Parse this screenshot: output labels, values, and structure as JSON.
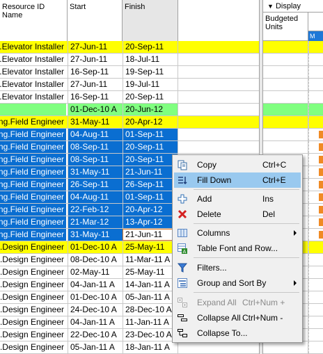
{
  "columns": {
    "resource": "Resource ID Name",
    "start": "Start",
    "finish": "Finish"
  },
  "display_tab": "Display",
  "right_columns": {
    "budgeted": "Budgeted Units",
    "mini": "M"
  },
  "rows": [
    {
      "resource": "Const.Elevator Installer",
      "start": "27-Jun-11",
      "finish": "20-Sep-11",
      "style": "yellow"
    },
    {
      "resource": "Const.Elevator Installer",
      "start": "27-Jun-11",
      "finish": "18-Jul-11",
      "style": ""
    },
    {
      "resource": "Const.Elevator Installer",
      "start": "16-Sep-11",
      "finish": "19-Sep-11",
      "style": ""
    },
    {
      "resource": "Const.Elevator Installer",
      "start": "27-Jun-11",
      "finish": "19-Jul-11",
      "style": ""
    },
    {
      "resource": "Const.Elevator Installer",
      "start": "16-Sep-11",
      "finish": "20-Sep-11",
      "style": ""
    },
    {
      "resource": "",
      "start": "01-Dec-10 A",
      "finish": "20-Jun-12",
      "style": "green"
    },
    {
      "resource": "FieldEng.Field Engineer",
      "start": "31-May-11",
      "finish": "20-Apr-12",
      "style": "yellow"
    },
    {
      "resource": "FieldEng.Field Engineer",
      "start": "04-Aug-11",
      "finish": "01-Sep-11",
      "style": "blue"
    },
    {
      "resource": "FieldEng.Field Engineer",
      "start": "08-Sep-11",
      "finish": "20-Sep-11",
      "style": "blue"
    },
    {
      "resource": "FieldEng.Field Engineer",
      "start": "08-Sep-11",
      "finish": "20-Sep-11",
      "style": "blue"
    },
    {
      "resource": "FieldEng.Field Engineer",
      "start": "31-May-11",
      "finish": "21-Jun-11",
      "style": "blue"
    },
    {
      "resource": "FieldEng.Field Engineer",
      "start": "26-Sep-11",
      "finish": "26-Sep-11",
      "style": "blue"
    },
    {
      "resource": "FieldEng.Field Engineer",
      "start": "04-Aug-11",
      "finish": "01-Sep-11",
      "style": "blue"
    },
    {
      "resource": "FieldEng.Field Engineer",
      "start": "22-Feb-12",
      "finish": "20-Apr-12",
      "style": "blue"
    },
    {
      "resource": "FieldEng.Field Engineer",
      "start": "21-Mar-12",
      "finish": "13-Apr-12",
      "style": "blue"
    },
    {
      "resource": "FieldEng.Field Engineer",
      "start": "31-May-11",
      "finish": "21-Jun-11",
      "style": "blue editing"
    },
    {
      "resource": "FieldEng.Design Engineer",
      "start": "01-Dec-10 A",
      "finish": "25-May-11",
      "style": "yellow"
    },
    {
      "resource": "FieldEng.Design Engineer",
      "start": "08-Dec-10 A",
      "finish": "11-Mar-11 A",
      "style": ""
    },
    {
      "resource": "FieldEng.Design Engineer",
      "start": "02-May-11",
      "finish": "25-May-11",
      "style": ""
    },
    {
      "resource": "FieldEng.Design Engineer",
      "start": "04-Jan-11 A",
      "finish": "14-Jan-11 A",
      "style": ""
    },
    {
      "resource": "FieldEng.Design Engineer",
      "start": "01-Dec-10 A",
      "finish": "05-Jan-11 A",
      "style": ""
    },
    {
      "resource": "FieldEng.Design Engineer",
      "start": "24-Dec-10 A",
      "finish": "28-Dec-10 A",
      "style": ""
    },
    {
      "resource": "FieldEng.Design Engineer",
      "start": "04-Jan-11 A",
      "finish": "11-Jan-11 A",
      "style": ""
    },
    {
      "resource": "FieldEng.Design Engineer",
      "start": "22-Dec-10 A",
      "finish": "23-Dec-10 A",
      "style": ""
    },
    {
      "resource": "FieldEng.Design Engineer",
      "start": "05-Jan-11 A",
      "finish": "18-Jan-11 A",
      "style": ""
    }
  ],
  "context_menu": {
    "copy": {
      "label": "Copy",
      "shortcut": "Ctrl+C"
    },
    "fill_down": {
      "label": "Fill Down",
      "shortcut": "Ctrl+E"
    },
    "add": {
      "label": "Add",
      "shortcut": "Ins"
    },
    "delete": {
      "label": "Delete",
      "shortcut": "Del"
    },
    "columns": {
      "label": "Columns"
    },
    "table_font": {
      "label": "Table Font and Row..."
    },
    "filters": {
      "label": "Filters..."
    },
    "group_sort": {
      "label": "Group and Sort By"
    },
    "expand_all": {
      "label": "Expand All",
      "shortcut": "Ctrl+Num +"
    },
    "collapse_all": {
      "label": "Collapse All",
      "shortcut": "Ctrl+Num -"
    },
    "collapse_to": {
      "label": "Collapse To..."
    }
  }
}
